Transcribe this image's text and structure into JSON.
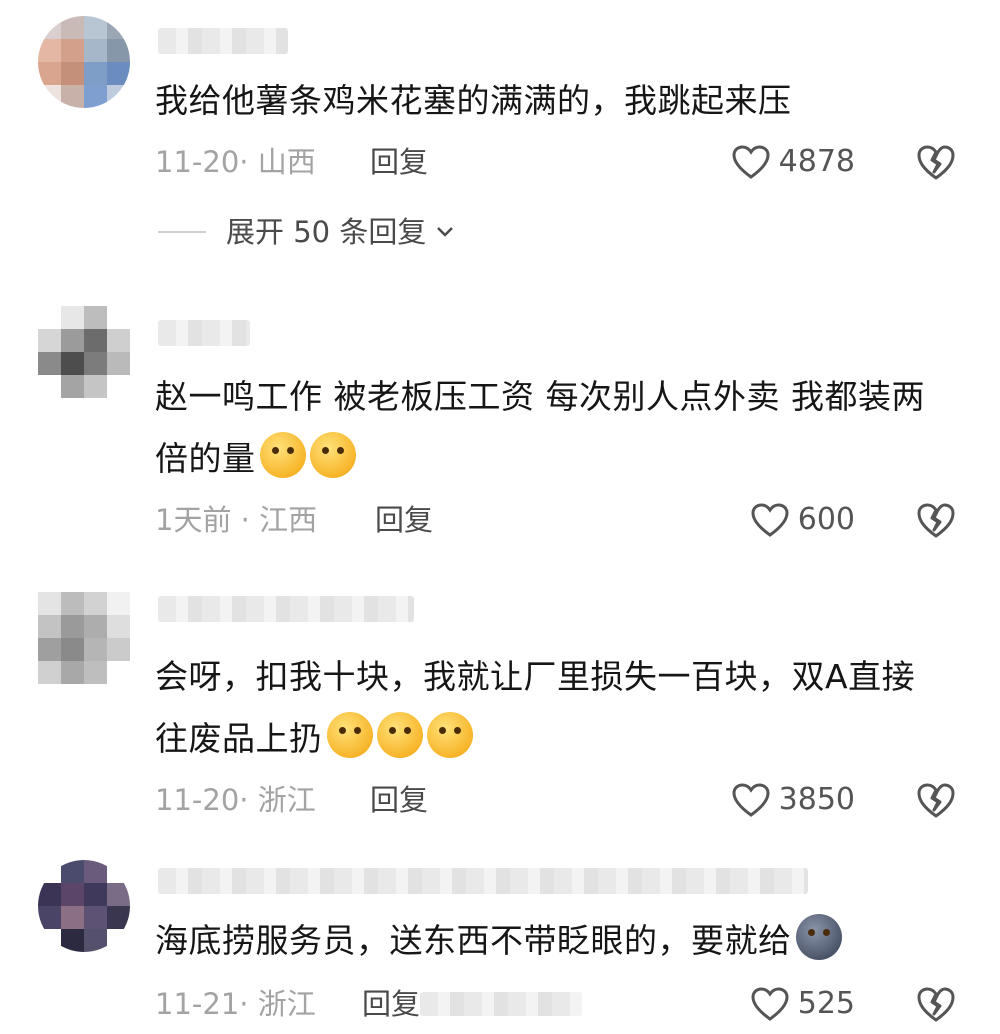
{
  "comments": [
    {
      "text": "我给他薯条鸡米花塞的满满的，我跳起来压",
      "meta": "11-20· 山西",
      "reply_label": "回复",
      "likes": "4878",
      "expand_label": "展开 50 条回复"
    },
    {
      "text": "赵一鸣工作 被老板压工资 每次别人点外卖 我都装两倍的量",
      "meta": "1天前 · 江西",
      "reply_label": "回复",
      "likes": "600"
    },
    {
      "text": "会呀，扣我十块，我就让厂里损失一百块，双A直接往废品上扔",
      "meta": "11-20· 浙江",
      "reply_label": "回复",
      "likes": "3850"
    },
    {
      "text": "海底捞服务员，送东西不带眨眼的，要就给",
      "meta": "11-21· 浙江",
      "reply_label": "回复",
      "likes": "525"
    }
  ],
  "icons": {
    "like": "heart-outline-icon",
    "dislike": "broken-heart-icon",
    "expand": "chevron-down-icon"
  },
  "colors": {
    "text": "#161616",
    "meta": "#a3a3a3",
    "action": "#4a4a4a",
    "icon": "#555555"
  }
}
